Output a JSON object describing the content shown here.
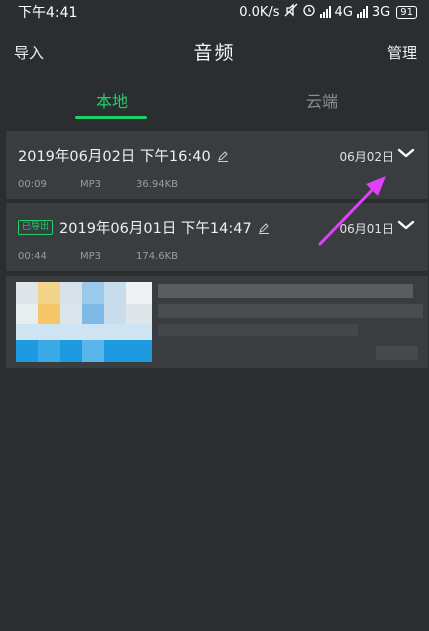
{
  "statusbar": {
    "time": "下午4:41",
    "speed": "0.0K/s",
    "net1": "4G",
    "net2": "3G",
    "battery": "91"
  },
  "header": {
    "left_label": "导入",
    "title": "音频",
    "right_label": "管理"
  },
  "tabs": [
    {
      "label": "本地"
    },
    {
      "label": "云端"
    }
  ],
  "recordings": [
    {
      "title": "2019年06月02日 下午16:40",
      "date": "06月02日",
      "duration": "00:09",
      "format": "MP3",
      "size": "36.94KB",
      "badge": ""
    },
    {
      "title": "2019年06月01日 下午14:47",
      "date": "06月01日",
      "duration": "00:44",
      "format": "MP3",
      "size": "174.6KB",
      "badge": "已导出"
    }
  ],
  "colors": {
    "accent": "#1fd068",
    "background": "#2b2e31",
    "card": "#3a3d40",
    "annotation_arrow": "#e040fb"
  }
}
